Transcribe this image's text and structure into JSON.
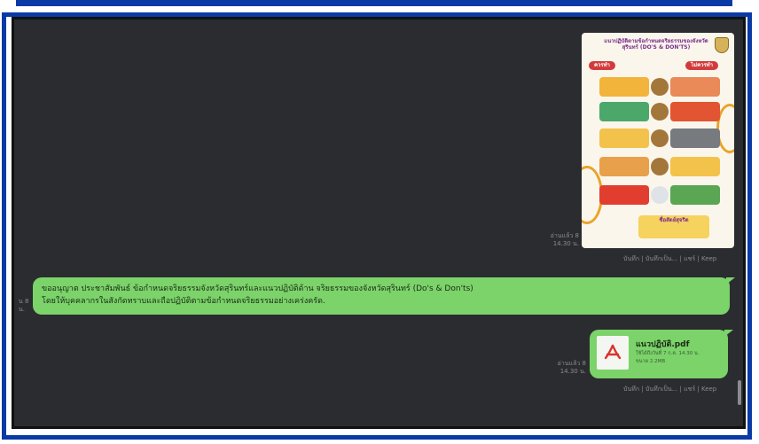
{
  "poster": {
    "title": "แนวปฏิบัติตามข้อกำหนดจริยธรรมของจังหวัดสุรินทร์ (DO'S & DON'TS)",
    "do_label": "ควรทำ",
    "dont_label": "ไม่ควรทำ",
    "footer_text": "ซื่อสัตย์สุจริต"
  },
  "image_msg": {
    "read": "อ่านแล้ว 8",
    "time": "14.30 น.",
    "actions": [
      "บันทึก",
      "บันทึกเป็น...",
      "แชร์",
      "Keep"
    ]
  },
  "text_msg": {
    "line1": "ขออนุญาต ประชาสัมพันธ์ ข้อกำหนดจริยธรรมจังหวัดสุรินทร์และแนวปฏิบัติด้าน จริยธรรมของจังหวัดสุรินทร์ (Do's & Don'ts)",
    "line2": "โดยให้บุคคลากรในสังกัดทราบและถือปฏิบัติตามข้อกำหนดจริยธรรมอย่างเคร่งครัด.",
    "left_meta_1": "น 8",
    "left_meta_2": "น."
  },
  "file_msg": {
    "name": "แนวปฏิบัติ.pdf",
    "expiry": "ใช้ได้ถึงวันที่ 7 ก.ค. 14.30 น.",
    "size": "ขนาด 2.2MB",
    "read": "อ่านแล้ว 8",
    "time": "14.30 น.",
    "actions": [
      "บันทึก",
      "บันทึกเป็น...",
      "แชร์",
      "Keep"
    ]
  },
  "colors": {
    "frame": "#0a3aa5",
    "bubble": "#7bd36a",
    "chat_bg": "#2b2c2f"
  },
  "icons": [
    "pdf-icon",
    "crest-icon"
  ]
}
